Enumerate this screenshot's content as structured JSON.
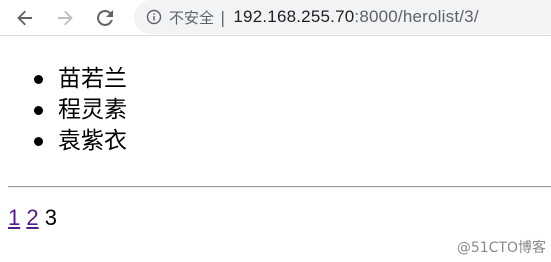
{
  "browser": {
    "security_label": "不安全",
    "separator": "|",
    "url_host": "192.168.255.70",
    "url_rest": ":8000/herolist/3/",
    "icons": {
      "back": "back-arrow-icon",
      "forward": "forward-arrow-icon",
      "reload": "reload-icon",
      "info": "info-icon"
    }
  },
  "heroes": [
    {
      "name": "苗若兰"
    },
    {
      "name": "程灵素"
    },
    {
      "name": "袁紫衣"
    }
  ],
  "pagination": {
    "pages": [
      {
        "label": "1",
        "current": false
      },
      {
        "label": "2",
        "current": false
      },
      {
        "label": "3",
        "current": true
      }
    ],
    "link_color": "#551a8b"
  },
  "watermark": "@51CTO博客"
}
